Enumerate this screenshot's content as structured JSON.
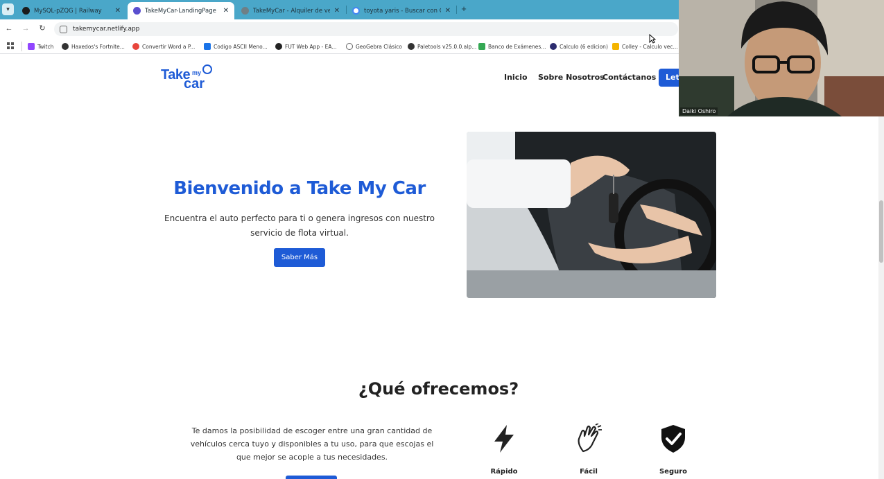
{
  "tabs": [
    {
      "title": "MySQL-pZQG | Railway",
      "active": false,
      "favicon": "railway-icon"
    },
    {
      "title": "TakeMyCar-LandingPage",
      "active": true,
      "favicon": "netlify-icon"
    },
    {
      "title": "TakeMyCar - Alquiler de vehícu",
      "active": false,
      "favicon": "globe-icon"
    },
    {
      "title": "toyota yaris - Buscar con Goog",
      "active": false,
      "favicon": "google-icon"
    }
  ],
  "address": {
    "url": "takemycar.netlify.app"
  },
  "bookmarks": [
    {
      "label": "Twitch",
      "color": "#9146ff"
    },
    {
      "label": "Haxedos's Fortnite...",
      "color": "#333333"
    },
    {
      "label": "Convertir Word a P...",
      "color": "#e8453c"
    },
    {
      "label": "Codigo ASCII Meno...",
      "color": "#1a73e8"
    },
    {
      "label": "FUT Web App - EA...",
      "color": "#222222"
    },
    {
      "label": "GeoGebra Clásico",
      "color": "#666666"
    },
    {
      "label": "Paletools v25.0.0.alp...",
      "color": "#333333"
    },
    {
      "label": "Banco de Exámenes...",
      "color": "#34a853"
    },
    {
      "label": "Calculo (6 edicion)",
      "color": "#2b2b6e"
    },
    {
      "label": "Colley - Calculo vec...",
      "color": "#f4b400"
    }
  ],
  "site": {
    "logo": {
      "take": "Take",
      "my": "my",
      "car": "car"
    },
    "nav": [
      "Inicio",
      "Sobre Nosotros",
      "Contáctanos"
    ],
    "nav_cta": "Let's",
    "hero": {
      "title": "Bienvenido a Take My Car",
      "subtitle": "Encuentra el auto perfecto para ti o genera ingresos con nuestro servicio de flota virtual.",
      "button": "Saber Más"
    },
    "offer": {
      "title": "¿Qué ofrecemos?",
      "text": "Te damos la posibilidad de escoger entre una gran cantidad de vehículos cerca tuyo y disponibles a tu uso, para que escojas el que mejor se acople a tus necesidades.",
      "features": [
        {
          "label": "Rápido",
          "icon": "lightning-icon"
        },
        {
          "label": "Fácil",
          "icon": "hand-wave-icon"
        },
        {
          "label": "Seguro",
          "icon": "shield-check-icon"
        }
      ]
    }
  },
  "webcam": {
    "name": "Daiki Oshiro"
  },
  "colors": {
    "brand": "#1e5bd6",
    "tabstrip": "#4aa7c9"
  }
}
